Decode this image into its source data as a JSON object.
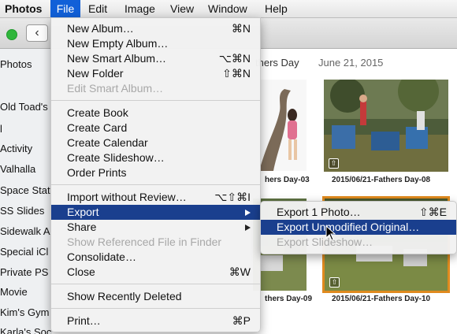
{
  "menubar": {
    "app": "Photos",
    "items": [
      "File",
      "Edit",
      "Image",
      "View",
      "Window",
      "Help"
    ]
  },
  "sidebar": {
    "items": [
      "Photos",
      "Old Toad's",
      "l",
      "Activity",
      "Valhalla",
      "Space Stat",
      "SS Slides",
      "Sidewalk A",
      "Special iCl",
      "Private PS",
      "Movie",
      "Kim's Gym",
      "Karla's Soccer and Equestrian"
    ]
  },
  "content": {
    "moment_title": "thers Day",
    "moment_date": "June 21, 2015",
    "photos": [
      {
        "caption": "hers Day-03"
      },
      {
        "caption": "2015/06/21-Fathers Day-08"
      },
      {
        "caption": "thers Day-09"
      },
      {
        "caption": "2015/06/21-Fathers Day-10"
      }
    ]
  },
  "file_menu": {
    "items": [
      {
        "label": "New Album…",
        "shortcut": "⌘N"
      },
      {
        "label": "New Empty Album…",
        "shortcut": ""
      },
      {
        "label": "New Smart Album…",
        "shortcut": "⌥⌘N"
      },
      {
        "label": "New Folder",
        "shortcut": "⇧⌘N"
      },
      {
        "label": "Edit Smart Album…",
        "shortcut": ""
      },
      {
        "label": "Create Book",
        "shortcut": ""
      },
      {
        "label": "Create Card",
        "shortcut": ""
      },
      {
        "label": "Create Calendar",
        "shortcut": ""
      },
      {
        "label": "Create Slideshow…",
        "shortcut": ""
      },
      {
        "label": "Order Prints",
        "shortcut": ""
      },
      {
        "label": "Import without Review…",
        "shortcut": "⌥⇧⌘I"
      },
      {
        "label": "Export",
        "shortcut": ""
      },
      {
        "label": "Share",
        "shortcut": ""
      },
      {
        "label": "Show Referenced File in Finder",
        "shortcut": ""
      },
      {
        "label": "Consolidate…",
        "shortcut": ""
      },
      {
        "label": "Close",
        "shortcut": "⌘W"
      },
      {
        "label": "Show Recently Deleted",
        "shortcut": ""
      },
      {
        "label": "Print…",
        "shortcut": "⌘P"
      }
    ]
  },
  "export_submenu": {
    "items": [
      {
        "label": "Export 1 Photo…",
        "shortcut": "⇧⌘E"
      },
      {
        "label": "Export Unmodified Original…",
        "shortcut": ""
      },
      {
        "label": "Export Slideshow…",
        "shortcut": ""
      }
    ]
  },
  "colors": {
    "highlight": "#1a3f8e",
    "menubar_active": "#1160d8",
    "selection_border": "#e08a1e",
    "window_green": "#2fb63b"
  }
}
